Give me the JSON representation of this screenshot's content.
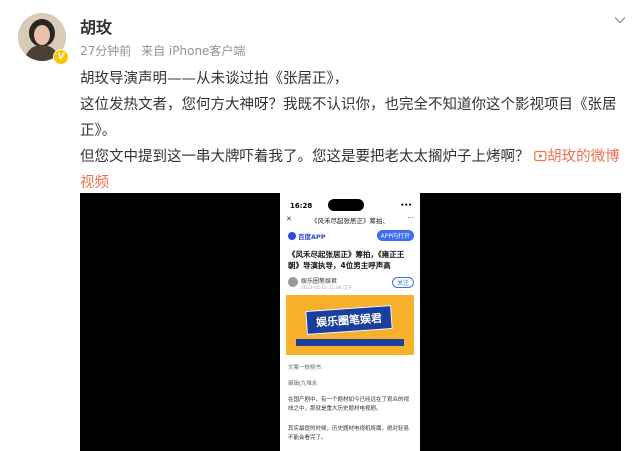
{
  "user": {
    "name": "胡玫",
    "time": "27分钟前",
    "source": "来自 iPhone客户端"
  },
  "post": {
    "line1": "胡玫导演声明——从未谈过拍《张居正》，",
    "line2": "这位发热文者，您何方大神呀？我既不认识你，也完全不知道你这个影视项目《张居正》。",
    "line3": "但您文中提到这一串大牌吓着我了。您这是要把老太太搁炉子上烤啊？",
    "video_link": "胡玫的微博视频"
  },
  "video": {
    "status_time": "16:28",
    "status_signal": "••• ",
    "page_title": "《风禾尽起张居正》筹拍、",
    "brand": "百度APP",
    "open_app": "APP内打开",
    "headline": "《风禾尽起张居正》筹拍，《雍正王朝》导演执导，4位男主呼声高",
    "author": "娱乐圈笔娱君",
    "date": "2023-05-13 11:08 辽宁",
    "follow": "关注",
    "banner_text": "娱乐圈笔娱君",
    "section1": "文案一枝桃书",
    "section2": "编辑|九堆永",
    "body1": "在国产剧中，有一个题材如今已经远在了观众的视线之中，那就是重大历史题材电视剧。",
    "body2": "其实最提的时候，历史题材电视机将属，绝对轻易不能会看完了。"
  }
}
